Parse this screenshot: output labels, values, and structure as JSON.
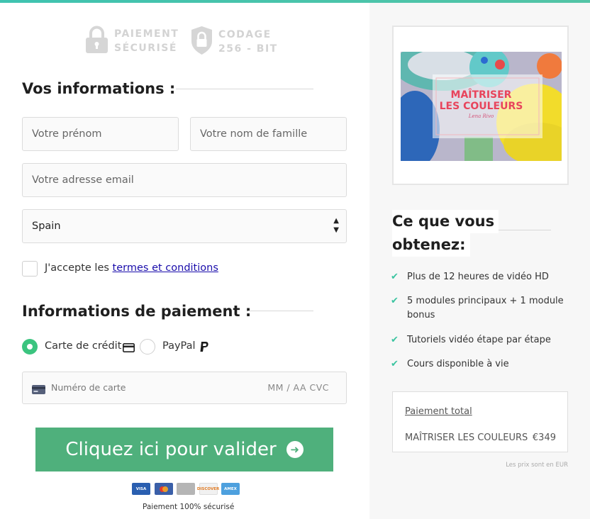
{
  "badges": {
    "payment": {
      "line1": "PAIEMENT",
      "line2": "SÉCURISÉ",
      "icon": "lock-icon"
    },
    "encryption": {
      "line1": "CODAGE",
      "line2": "256 - BIT",
      "icon": "shield-lock-icon"
    }
  },
  "info_section": {
    "title": "Vos informations :",
    "first_name_placeholder": "Votre prénom",
    "last_name_placeholder": "Votre nom de famille",
    "email_placeholder": "Votre adresse email",
    "country_value": "Spain",
    "terms_prefix": "J'accepte les ",
    "terms_link": "termes et conditions"
  },
  "payment_section": {
    "title": "Informations de paiement :",
    "methods": [
      {
        "label": "Carte de crédit",
        "selected": true,
        "icon": "credit-card-icon"
      },
      {
        "label": "PayPal",
        "selected": false,
        "icon": "paypal-icon"
      }
    ],
    "card_placeholder": "Numéro de carte",
    "expiry_cvc_placeholder": "MM / AA  CVC",
    "submit_label": "Cliquez ici pour valider",
    "card_logos": [
      "VISA",
      "MasterCard",
      "Card",
      "DISCOVER",
      "AMEX"
    ],
    "secure_text": "Paiement 100% sécurisé"
  },
  "product": {
    "image_title_line1": "MAÎTRISER",
    "image_title_line2": "LES COULEURS",
    "image_signature": "Lena Rivo"
  },
  "benefits": {
    "title_line1": "Ce que vous",
    "title_line2": "obtenez:",
    "items": [
      "Plus de 12 heures de vidéo HD",
      "5 modules principaux + 1 module bonus",
      "Tutoriels vidéo étape par étape",
      "Cours disponible à vie"
    ]
  },
  "summary": {
    "total_label": "Paiement total",
    "item_name": "MAÎTRISER LES COULEURS",
    "item_price": "€349",
    "currency_note": "Les prix sont en EUR"
  },
  "colors": {
    "accent_green": "#4fb07c",
    "radio_green": "#3bc47f",
    "check_teal": "#3bc4a0"
  }
}
